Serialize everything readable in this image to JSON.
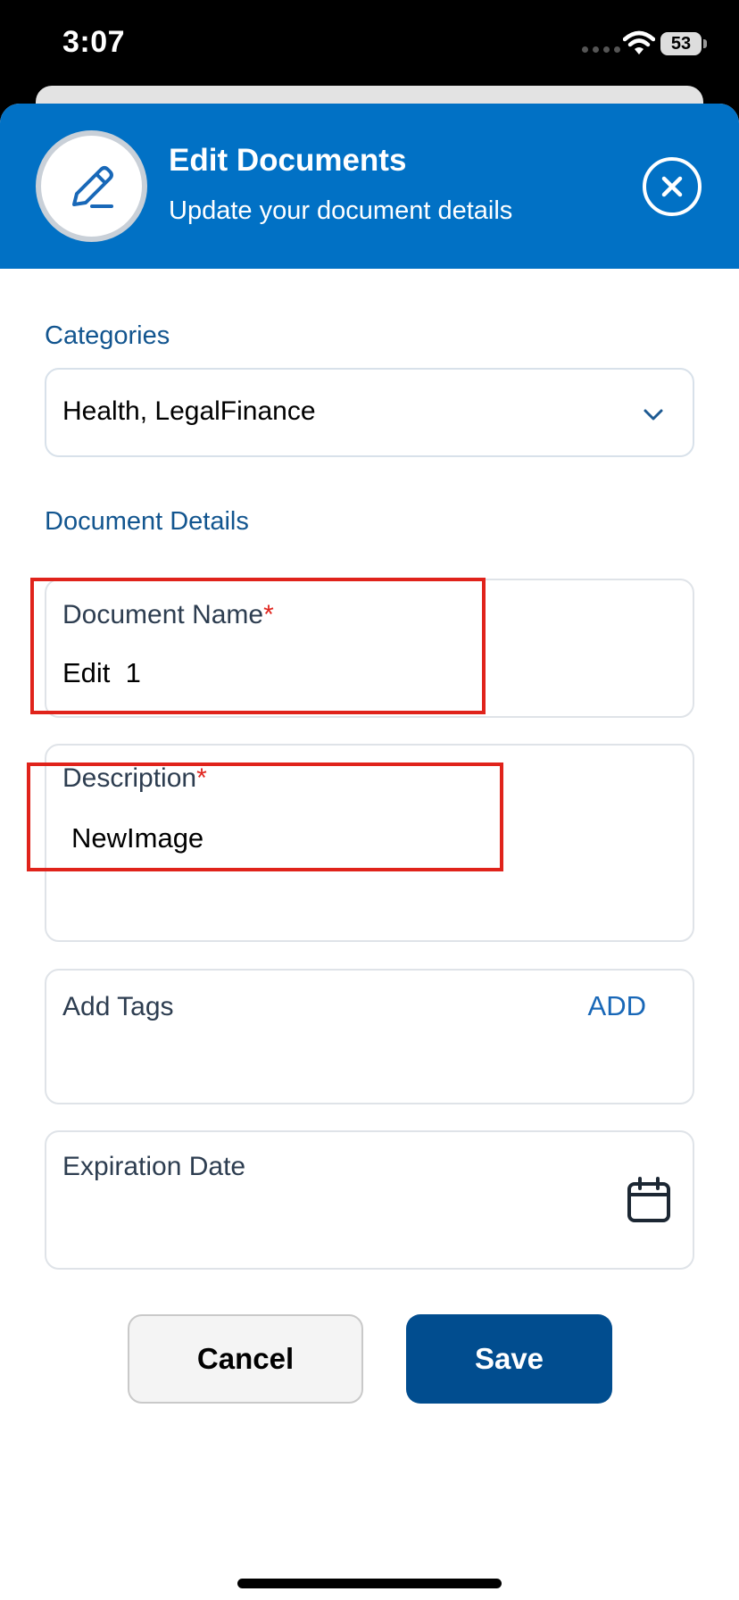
{
  "status_bar": {
    "time": "3:07",
    "battery": "53"
  },
  "modal": {
    "title": "Edit Documents",
    "subtitle": "Update your document details",
    "header_icon": "pencil-icon",
    "close_icon": "close-circle-icon"
  },
  "categories": {
    "label": "Categories",
    "value": "Health, LegalFinance"
  },
  "document_details": {
    "label": "Document Details",
    "name_label": "Document Name",
    "name_value": "Edit  1",
    "description_label": "Description",
    "description_value": "NewImage",
    "required_mark": "*",
    "tags_label": "Add Tags",
    "tags_action": "ADD",
    "expiration_label": "Expiration Date"
  },
  "actions": {
    "cancel": "Cancel",
    "save": "Save"
  },
  "colors": {
    "header_bg": "#0171c5",
    "accent": "#12558f",
    "save_bg": "#014d8f",
    "required": "#e0261f",
    "highlight": "#e0231b"
  }
}
